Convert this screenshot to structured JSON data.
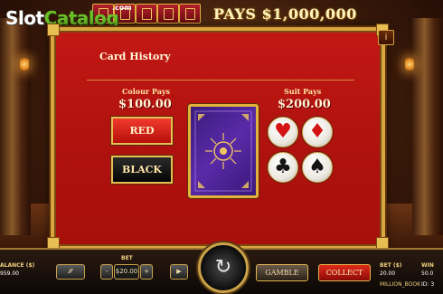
{
  "logo": {
    "slot": "Slot",
    "catalog": "Catalog",
    "com": ".com"
  },
  "header": {
    "pays_text": "PAYS $1,000,000"
  },
  "panel": {
    "title": "Card History",
    "close_label": "i",
    "colour": {
      "label": "Colour Pays",
      "amount": "$100.00",
      "red_label": "RED",
      "black_label": "BLACK"
    },
    "suit": {
      "label": "Suit Pays",
      "amount": "$200.00",
      "hearts": "♥",
      "diamonds": "♦",
      "clubs": "♣",
      "spades": "♠"
    }
  },
  "bottom": {
    "balance_label": "ALANCE ($)",
    "balance_value": "959.00",
    "bet_label_center": "BET",
    "bet_value": "$20.00",
    "minus": "-",
    "plus": "+",
    "autoplay_icon": "⁄⁄⁄",
    "play_icon": "▶",
    "spin_icon": "↻",
    "gamble_label": "GAMBLE",
    "collect_label": "COLLECT",
    "bet_label_right": "BET ($)",
    "bet_value_right": "20.00",
    "game_name": "MILLION_BOOK",
    "win_label": "WIN",
    "win_value": "50.0",
    "id_label": "ID: 3"
  },
  "colors": {
    "accent_gold": "#d7a640",
    "panel_red": "#b0120e",
    "card_purple": "#4a2290"
  }
}
